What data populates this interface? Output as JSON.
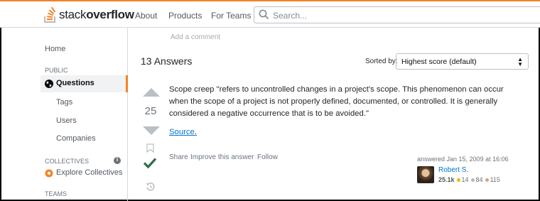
{
  "header": {
    "logo_text_light": "stack",
    "logo_text_bold": "overflow",
    "nav": [
      "About",
      "Products",
      "For Teams"
    ],
    "search_placeholder": "Search..."
  },
  "sidebar": {
    "home": "Home",
    "public_heading": "PUBLIC",
    "questions": "Questions",
    "tags": "Tags",
    "users": "Users",
    "companies": "Companies",
    "collectives_heading": "COLLECTIVES",
    "explore_collectives": "Explore Collectives",
    "teams_heading": "TEAMS"
  },
  "main": {
    "add_comment": "Add a comment",
    "answers_count": "13 Answers",
    "sorted_by_label": "Sorted by:",
    "sort_selected": "Highest score (default)",
    "answer": {
      "score": "25",
      "body": "Scope creep \"refers to uncontrolled changes in a project's scope. This phenomenon can occur when the scope of a project is not properly defined, documented, or controlled. It is generally considered a negative occurrence that is to be avoided.\"",
      "source_link": "Source",
      "source_trailing": ".",
      "actions": [
        "Share",
        "Improve this answer",
        "Follow"
      ],
      "answered_text": "answered Jan 15, 2009 at 16:06",
      "user_name": "Robert S.",
      "reputation": "25.1k",
      "gold": "14",
      "silver": "84",
      "bronze": "115"
    }
  },
  "colors": {
    "accent": "#f48225",
    "link": "#0074cc",
    "accepted": "#2f6f44",
    "gold": "#f1b600",
    "silver": "#b4b8bc",
    "bronze": "#d1a684"
  }
}
